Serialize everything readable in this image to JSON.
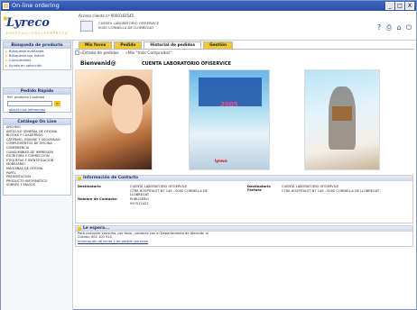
{
  "window": {
    "title": "On-line ordering",
    "controls": [
      "_",
      "□",
      "X"
    ]
  },
  "header": {
    "logo": "Lyreco",
    "tagline": "E N  S E R V I C I O  D E  L A  E M P R E S A",
    "client_heading": "Acceso cliente nº 0000162545",
    "client_line1": "CUENTA LABORATORIO OFISERVICE",
    "client_line2": "0000 CORNELLA DE LLOBREGAT",
    "icons": [
      "help-icon",
      "print-icon",
      "home-icon",
      "logout-icon"
    ]
  },
  "sidebar": {
    "search_title": "Búsqueda de producto",
    "search_links": [
      "Búsqueda avanzada",
      "Búsqueda por índice",
      "Consumibles",
      "Ayuda en selección"
    ],
    "order_title": "Pedido Rápido",
    "order_label": "Ref. producto Cantidad",
    "order_go": "»",
    "order_link": "añadir más referencias",
    "catalog_title": "Catálogo On Line",
    "catalog_items": [
      "ARCHIVO",
      "ARTÍCULO GENERAL DE OFICINA",
      "BLOCKS Y CUADERNOS",
      "CATERING, HIGIENE Y SEGURIDAD",
      "COMPLEMENTOS DE OFICINA",
      "CONFERENCIA",
      "CONSUMIBLES DE IMPRESIÓN",
      "ESCRITURA Y CORRECCIÓN",
      "ETIQUETAS E IDENTIFICACIÓN",
      "MOBILIARIO",
      "MÁQUINAS DE OFICINA",
      "PAPEL",
      "PRESENTACIÓN",
      "PRODUCTO INFORMÁTICO",
      "SOBRES Y ENVÍOS"
    ]
  },
  "main": {
    "tabs": [
      {
        "label": "Mis favos",
        "active": false
      },
      {
        "label": "Pedido",
        "active": false
      },
      {
        "label": "Historial de pedidos",
        "active": true
      },
      {
        "label": "Gestión",
        "active": false
      }
    ],
    "crumbs": [
      "Estado de pedidos",
      "Mis \"más Comprados\""
    ],
    "welcome": "Bienvenid@",
    "company": "CUENTA LABORATORIO OFISERVICE",
    "catalog_year": "2005",
    "catalog_brand": "lyreco",
    "contact": {
      "title": "Información de Contacto",
      "dest_label": "Destinatario",
      "dest_value": [
        "CUENTA LABORATORIO OFISERVICE",
        "CTRA HOSPITALET NT 149 - 0000 CORNELLA DE",
        "LLOBREGAT"
      ],
      "contact_label": "Nombre de Contacto:",
      "contact_value": [
        "PUBLISERVI",
        "937012421"
      ],
      "billing_label": "Destinatario Factura",
      "billing_value": [
        "CUENTA LABORATORIO OFISERVICE",
        "CTRA HOSPITALET NT 149 - 0000 CORNELLA DE LLOBREGAT"
      ]
    },
    "help": {
      "title": "Le espera...",
      "line1": "Para cualquier consulta, por favor, contacte con el Departamento de Atención al",
      "line2": "Cliente: 902 100 914",
      "link": "Información de venta y de gestión personal"
    }
  }
}
